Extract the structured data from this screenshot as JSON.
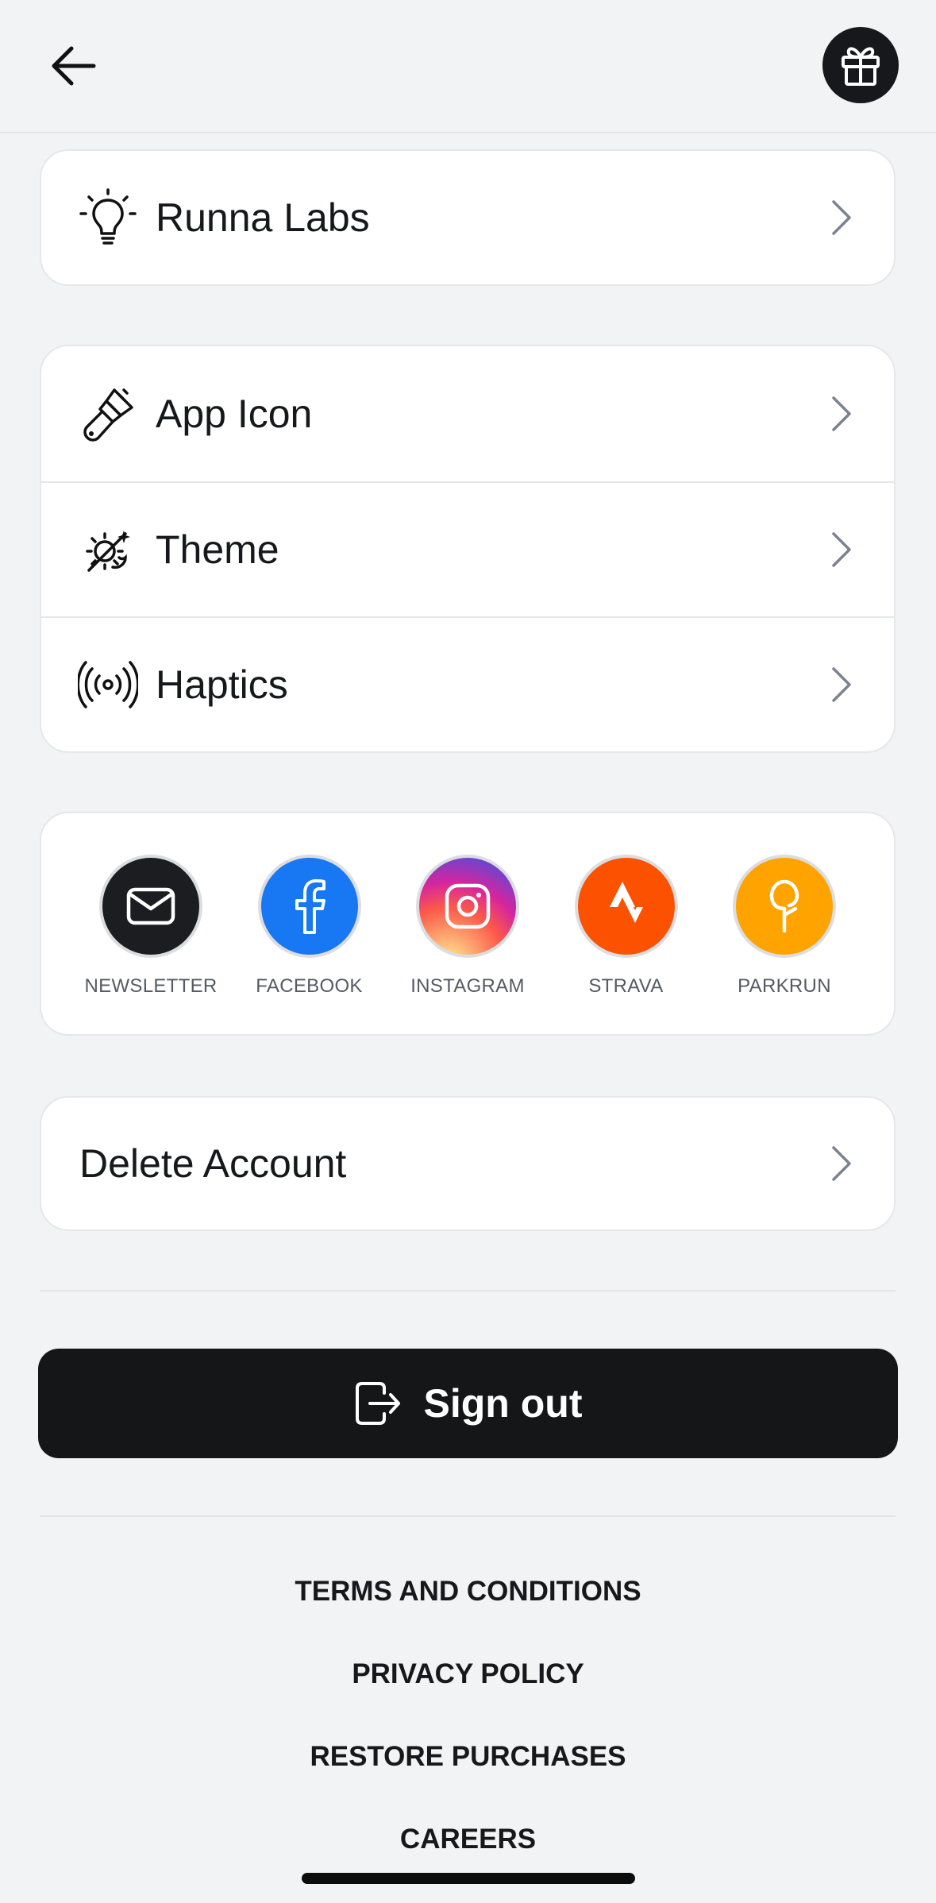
{
  "header": {
    "back_icon": "arrow-left-icon",
    "gift_icon": "gift-icon"
  },
  "labs": {
    "label": "Runna Labs",
    "icon": "lightbulb-icon"
  },
  "appearance": {
    "items": [
      {
        "label": "App Icon",
        "icon": "paintbrush-icon"
      },
      {
        "label": "Theme",
        "icon": "theme-sun-moon-icon"
      },
      {
        "label": "Haptics",
        "icon": "vibration-icon"
      }
    ]
  },
  "social": {
    "items": [
      {
        "label": "NEWSLETTER",
        "icon": "mail-icon",
        "color": "#1c1d20"
      },
      {
        "label": "FACEBOOK",
        "icon": "facebook-icon",
        "color": "#1877f2"
      },
      {
        "label": "INSTAGRAM",
        "icon": "instagram-icon",
        "color": "#d62976"
      },
      {
        "label": "STRAVA",
        "icon": "strava-icon",
        "color": "#fc5200"
      },
      {
        "label": "PARKRUN",
        "icon": "parkrun-icon",
        "color": "#ffa300"
      }
    ]
  },
  "account": {
    "delete_label": "Delete Account"
  },
  "signout": {
    "label": "Sign out",
    "icon": "sign-out-icon"
  },
  "footer": {
    "terms": "TERMS AND CONDITIONS",
    "privacy": "PRIVACY POLICY",
    "restore": "RESTORE PURCHASES",
    "careers": "CAREERS"
  }
}
